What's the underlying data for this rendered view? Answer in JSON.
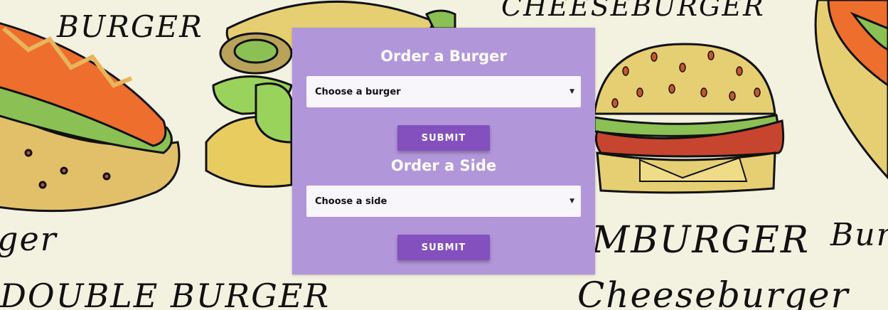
{
  "background": {
    "words": [
      "BURGER",
      "CHEESEBURGER",
      "DOUBLE BURGER",
      "MBURGER",
      "Cheeseburger",
      "Bur",
      "ger"
    ],
    "icon": "hand-drawn-burger-pattern"
  },
  "burger_form": {
    "title": "Order a Burger",
    "select_value": "Choose a burger",
    "submit_label": "SUBMIT"
  },
  "side_form": {
    "title": "Order a Side",
    "select_value": "Choose a side",
    "submit_label": "SUBMIT"
  },
  "colors": {
    "panel": "#b296da",
    "button": "#8450be",
    "select_bg": "#f8f6fb",
    "page_bg": "#f3f1e0"
  }
}
